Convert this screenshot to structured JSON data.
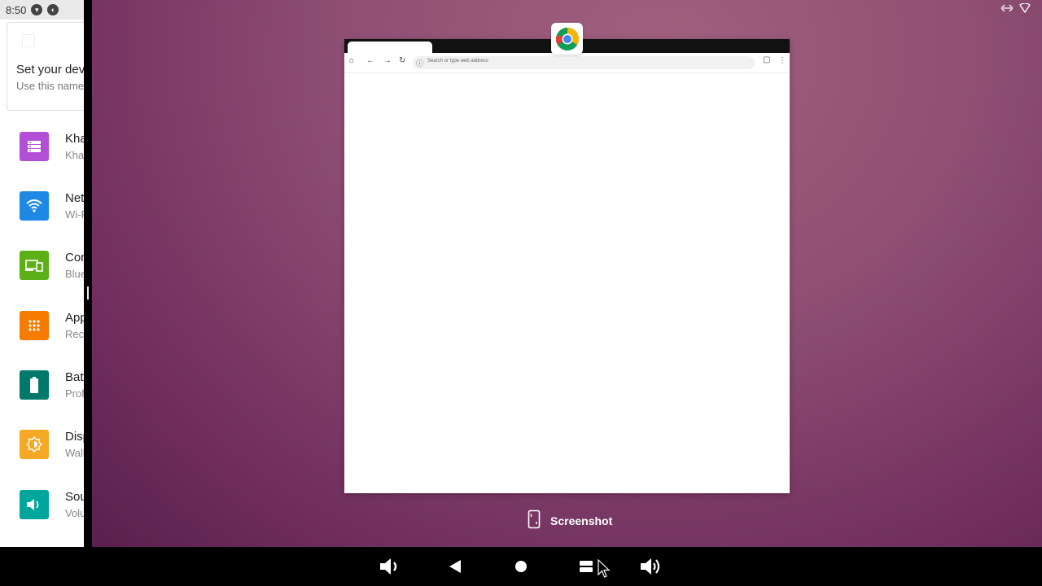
{
  "status_bar": {
    "time": "8:50"
  },
  "settings": {
    "name_card": {
      "title": "Set your device name",
      "subtitle": "Use this name"
    },
    "items": [
      {
        "title": "Kha",
        "subtitle": "Kha",
        "icon": "storage-icon",
        "color": "#b24fd6"
      },
      {
        "title": "Network & internet",
        "subtitle": "Wi-Fi",
        "icon": "wifi-icon",
        "color": "#1e88e5"
      },
      {
        "title": "Connected devices",
        "subtitle": "Bluetooth",
        "icon": "devices-icon",
        "color": "#5daf17"
      },
      {
        "title": "Apps",
        "subtitle": "Recent apps",
        "icon": "apps-icon",
        "color": "#f57c00"
      },
      {
        "title": "Battery",
        "subtitle": "Profile",
        "icon": "battery-icon",
        "color": "#00796b"
      },
      {
        "title": "Display",
        "subtitle": "Wallpaper",
        "icon": "display-icon",
        "color": "#f4a823"
      },
      {
        "title": "Sound",
        "subtitle": "Volume",
        "icon": "sound-icon",
        "color": "#00a69c"
      }
    ]
  },
  "browser": {
    "omnibox_placeholder": "Search or type web address"
  },
  "recents": {
    "screenshot_label": "Screenshot"
  },
  "nav": {
    "buttons": [
      "volume-down",
      "back",
      "home",
      "recents",
      "volume-up"
    ]
  }
}
